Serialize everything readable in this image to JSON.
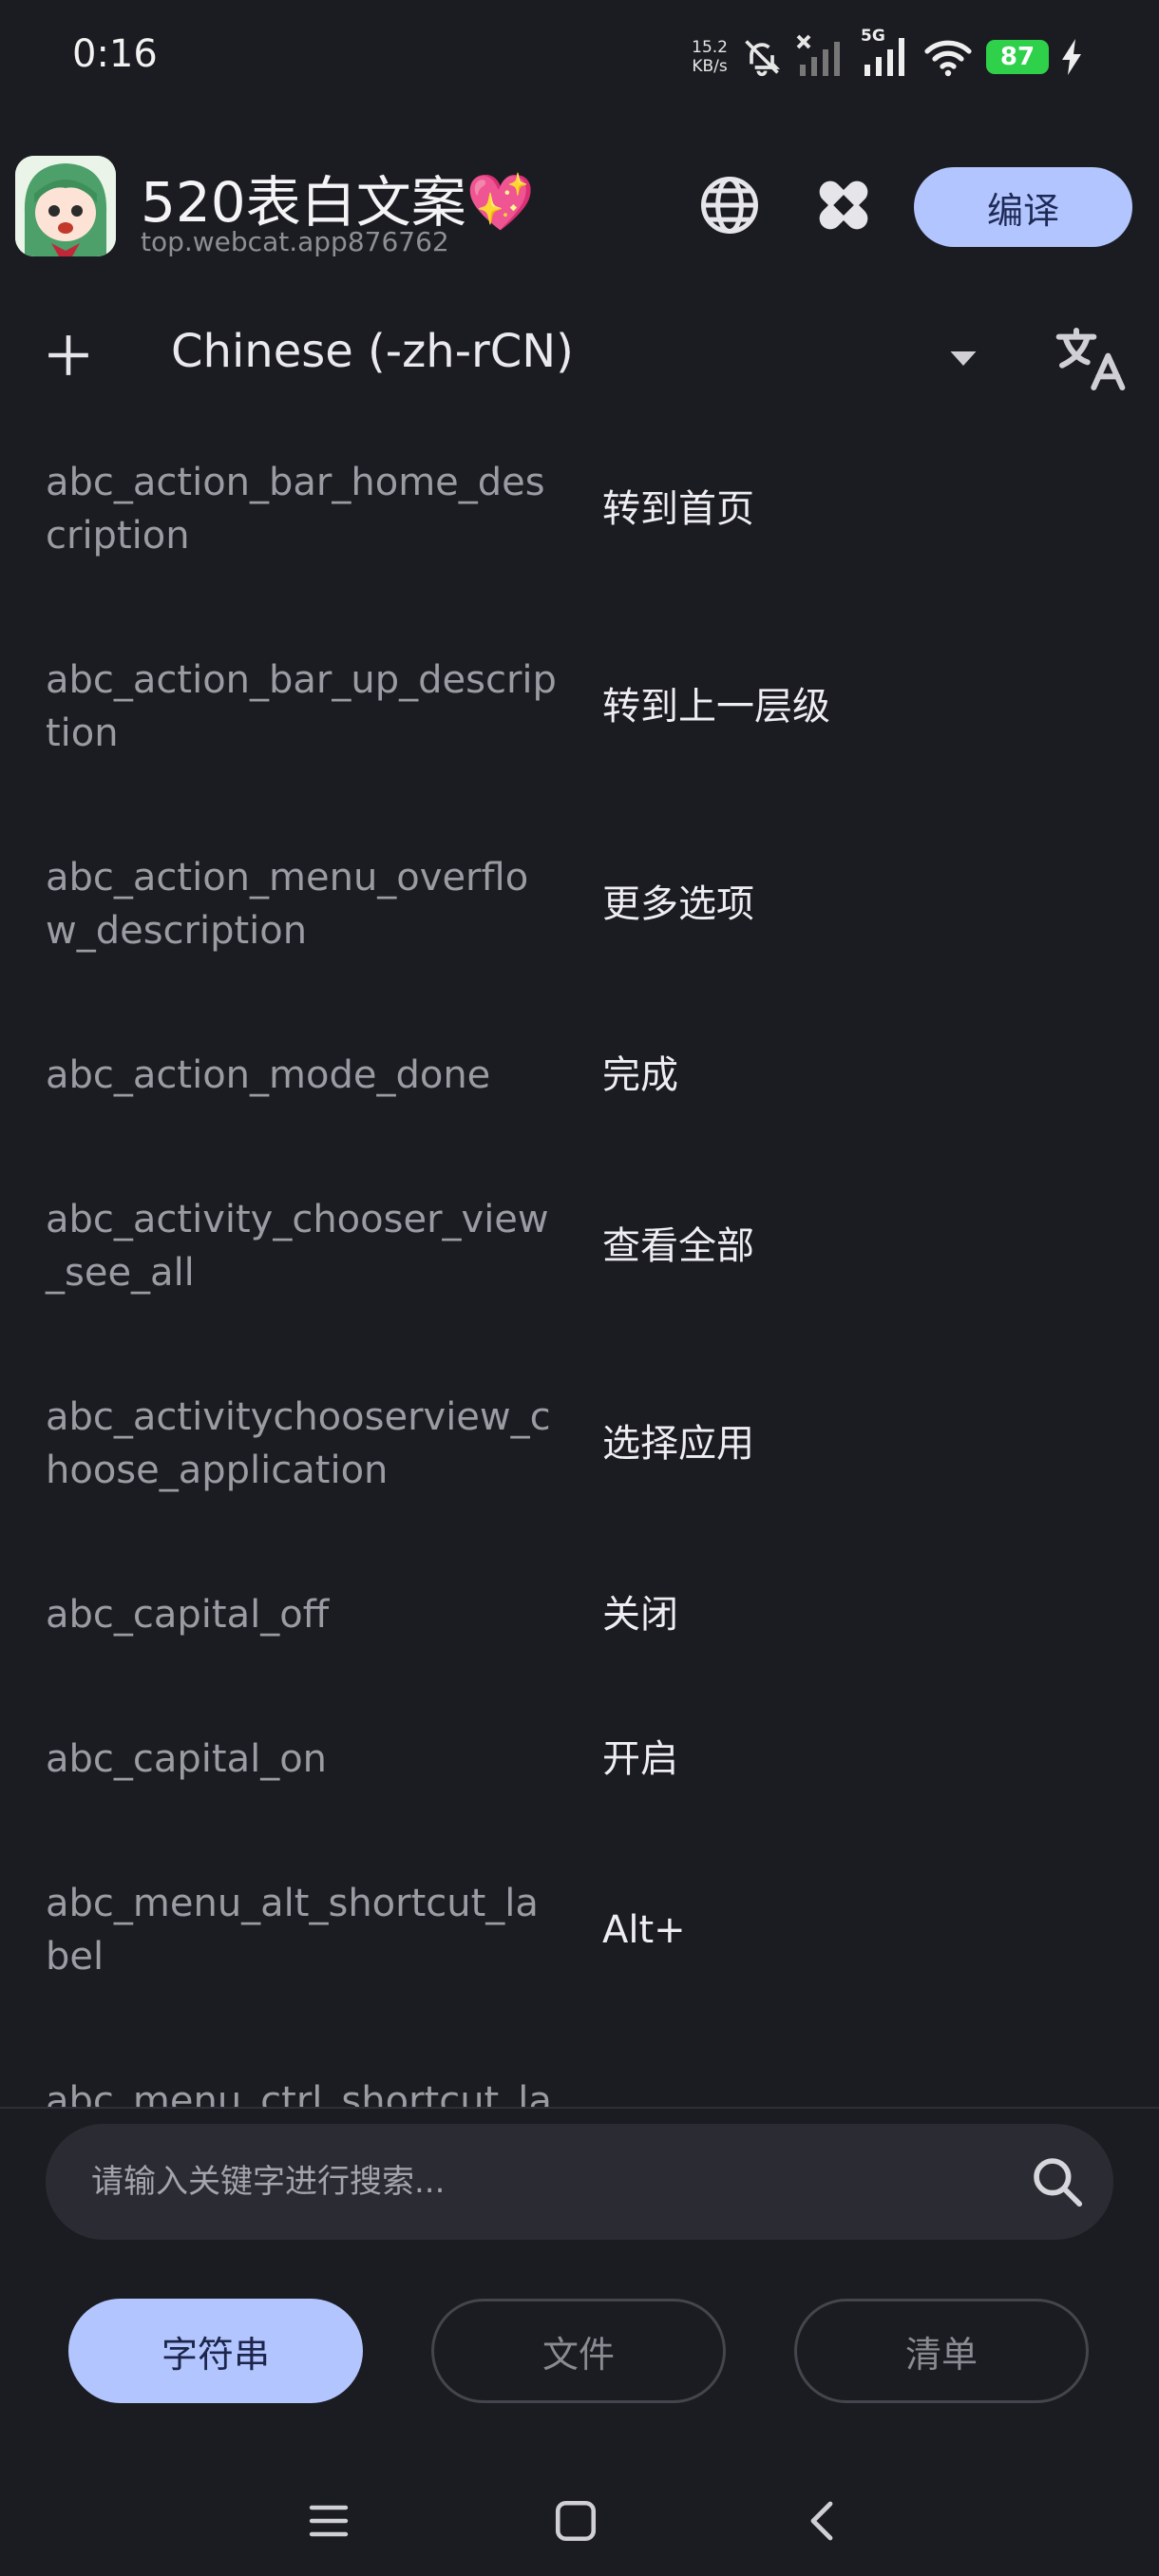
{
  "status_bar": {
    "time": "0:16",
    "net_speed_value": "15.2",
    "net_speed_unit": "KB/s",
    "network_label": "5G",
    "battery_level": "87"
  },
  "header": {
    "app_name": "520表白文案💖",
    "package_name": "top.webcat.app876762",
    "compile_label": "编译"
  },
  "language": {
    "selected": "Chinese (-zh-rCN)"
  },
  "strings": [
    {
      "key": "abc_action_bar_home_description",
      "value": "转到首页"
    },
    {
      "key": "abc_action_bar_up_description",
      "value": "转到上一层级"
    },
    {
      "key": "abc_action_menu_overflow_description",
      "value": "更多选项"
    },
    {
      "key": "abc_action_mode_done",
      "value": "完成"
    },
    {
      "key": "abc_activity_chooser_view_see_all",
      "value": "查看全部"
    },
    {
      "key": "abc_activitychooserview_choose_application",
      "value": "选择应用"
    },
    {
      "key": "abc_capital_off",
      "value": "关闭"
    },
    {
      "key": "abc_capital_on",
      "value": "开启"
    },
    {
      "key": "abc_menu_alt_shortcut_label",
      "value": "Alt+"
    },
    {
      "key": "abc_menu_ctrl_shortcut_label",
      "value": ""
    }
  ],
  "search": {
    "placeholder": "请输入关键字进行搜索..."
  },
  "tabs": [
    {
      "label": "字符串",
      "active": true
    },
    {
      "label": "文件",
      "active": false
    },
    {
      "label": "清单",
      "active": false
    }
  ],
  "colors": {
    "background": "#1b1c21",
    "accent": "#b3c5ff",
    "battery": "#2fd14b"
  }
}
